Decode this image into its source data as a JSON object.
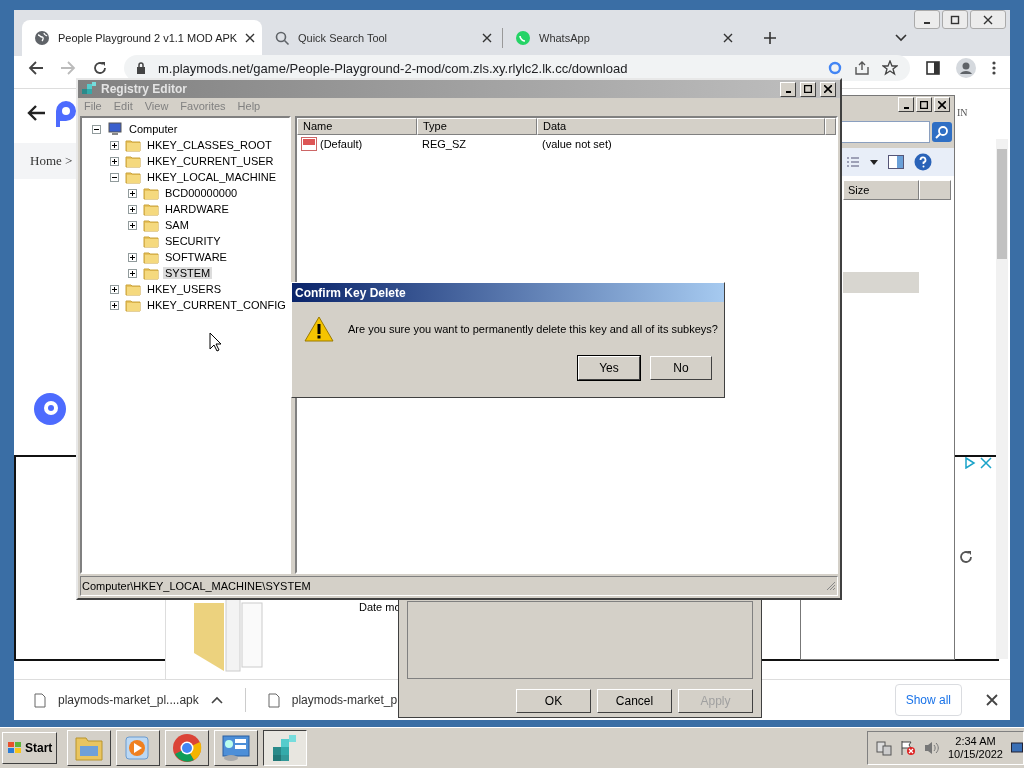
{
  "browser": {
    "tabs": [
      {
        "title": "People Playground 2 v1.1 MOD APK",
        "kind": "globe",
        "selected": true
      },
      {
        "title": "Quick Search Tool",
        "kind": "search",
        "selected": false
      },
      {
        "title": "WhatsApp",
        "kind": "chat",
        "selected": false
      }
    ],
    "url": "m.playmods.net/game/People-Playground-2-mod/com.zls.xy.rlylc2.lk.cc/download",
    "page": {
      "breadcrumb": "Home >",
      "sign_in": "IN"
    },
    "downloads": [
      {
        "file": "playmods-market_pl....apk"
      },
      {
        "file": "playmods-market_p"
      }
    ],
    "show_all": "Show all"
  },
  "explorer": {
    "column": "Size"
  },
  "properties": {
    "date_label": "Date mo",
    "buttons": [
      {
        "label": "OK",
        "disabled": false
      },
      {
        "label": "Cancel",
        "disabled": false
      },
      {
        "label": "Apply",
        "disabled": true
      }
    ]
  },
  "regedit": {
    "title": "Registry Editor",
    "menu": [
      "File",
      "Edit",
      "View",
      "Favorites",
      "Help"
    ],
    "tree": [
      {
        "label": "Computer",
        "kind": "computer",
        "expanded": true,
        "selected": false,
        "children": [
          {
            "label": "HKEY_CLASSES_ROOT",
            "expanded": false,
            "selected": false
          },
          {
            "label": "HKEY_CURRENT_USER",
            "expanded": false,
            "selected": false
          },
          {
            "label": "HKEY_LOCAL_MACHINE",
            "expanded": true,
            "selected": false,
            "children": [
              {
                "label": "BCD00000000",
                "expanded": false,
                "selected": false
              },
              {
                "label": "HARDWARE",
                "expanded": false,
                "selected": false
              },
              {
                "label": "SAM",
                "expanded": false,
                "selected": false
              },
              {
                "label": "SECURITY",
                "selected": false
              },
              {
                "label": "SOFTWARE",
                "expanded": false,
                "selected": false
              },
              {
                "label": "SYSTEM",
                "expanded": false,
                "selected": true
              }
            ]
          },
          {
            "label": "HKEY_USERS",
            "expanded": false,
            "selected": false
          },
          {
            "label": "HKEY_CURRENT_CONFIG",
            "expanded": false,
            "selected": false
          }
        ]
      }
    ],
    "columns": [
      "Name",
      "Type",
      "Data"
    ],
    "values": [
      {
        "name": "(Default)",
        "type": "REG_SZ",
        "data": "(value not set)"
      }
    ],
    "status": "Computer\\HKEY_LOCAL_MACHINE\\SYSTEM"
  },
  "dialog": {
    "title": "Confirm Key Delete",
    "message": "Are you sure you want to permanently delete this key and all of its subkeys?",
    "buttons": [
      {
        "label": "Yes",
        "selected": true
      },
      {
        "label": "No",
        "selected": false
      }
    ]
  },
  "taskbar": {
    "start": "Start",
    "apps": [
      {
        "kind": "folder",
        "active": false
      },
      {
        "kind": "media",
        "active": false
      },
      {
        "kind": "chrome",
        "active": false
      },
      {
        "kind": "panel",
        "active": false
      },
      {
        "kind": "registry",
        "active": true
      }
    ],
    "time": "2:34 AM",
    "date": "10/15/2022"
  }
}
